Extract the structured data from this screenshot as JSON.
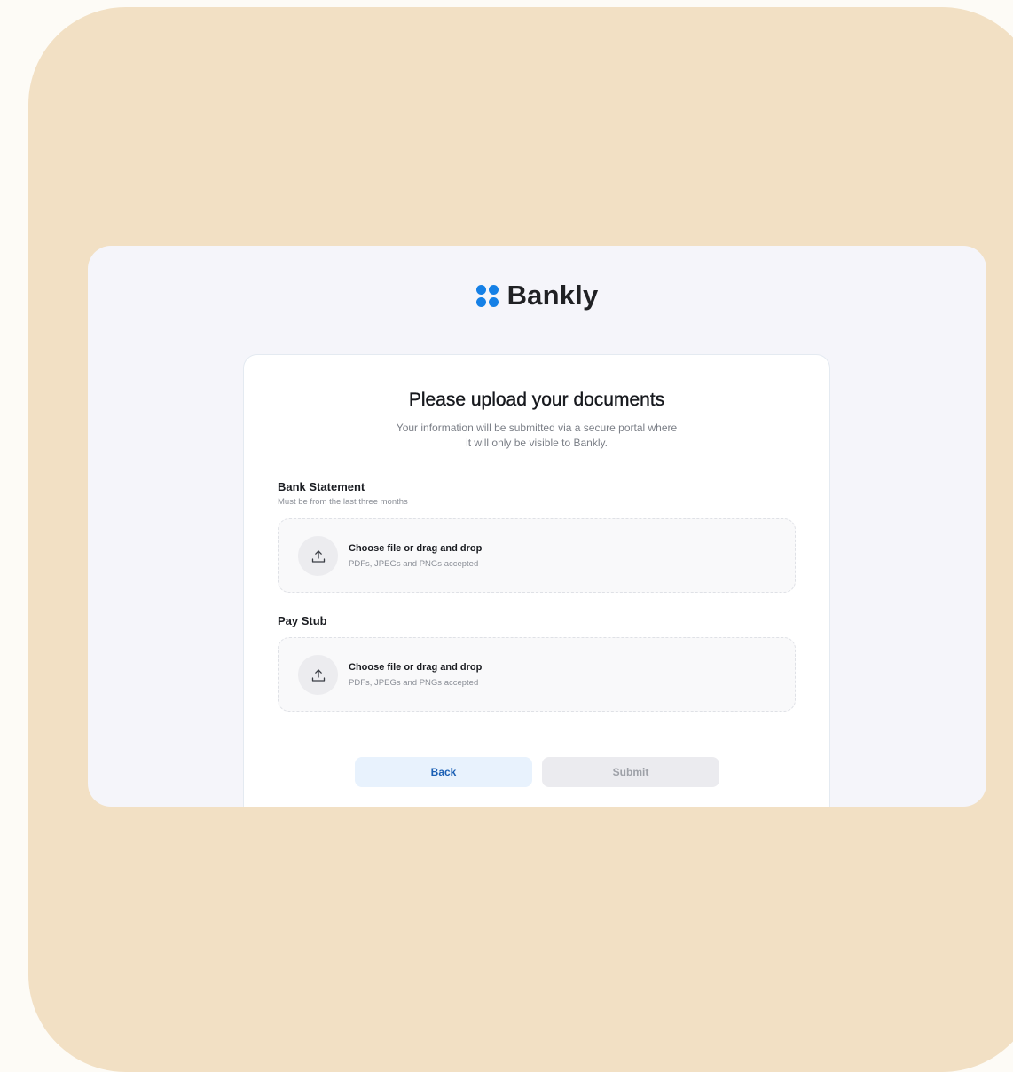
{
  "brand": {
    "name": "Bankly",
    "accent_color": "#1580e6",
    "icon": "four-dots-logo-icon"
  },
  "form": {
    "title": "Please upload your documents",
    "subtitle": "Your information will be submitted via a secure portal where it will only be visible to Bankly.",
    "sections": [
      {
        "label": "Bank Statement",
        "hint": "Must be from the last three months",
        "dropzone": {
          "title": "Choose file or drag and drop",
          "hint": "PDFs, JPEGs and PNGs accepted",
          "icon": "upload-icon"
        }
      },
      {
        "label": "Pay Stub",
        "dropzone": {
          "title": "Choose file or drag and drop",
          "hint": "PDFs, JPEGs and PNGs accepted",
          "icon": "upload-icon"
        }
      }
    ]
  },
  "actions": {
    "back_label": "Back",
    "submit_label": "Submit",
    "submit_enabled": false
  }
}
